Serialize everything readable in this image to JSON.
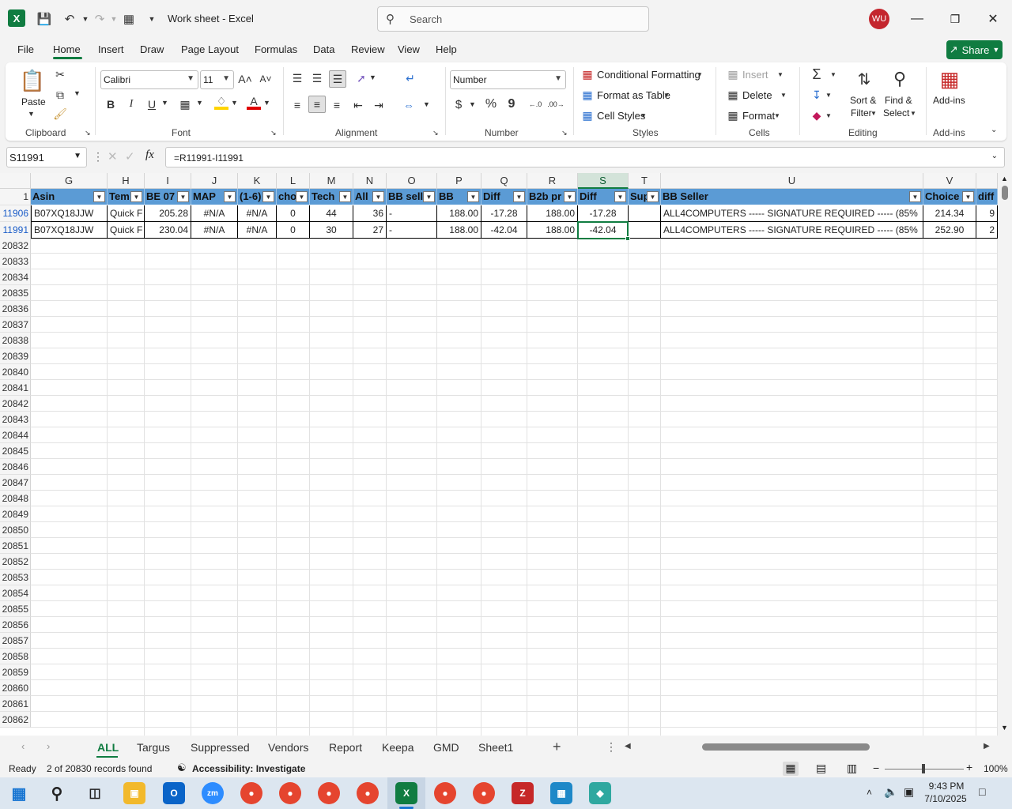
{
  "app": {
    "doc_title": "Work sheet  -  Excel",
    "search_placeholder": "Search",
    "user_initials": "WU",
    "share_label": "Share"
  },
  "menu": [
    "File",
    "Home",
    "Insert",
    "Draw",
    "Page Layout",
    "Formulas",
    "Data",
    "Review",
    "View",
    "Help"
  ],
  "ribbon": {
    "clipboard": {
      "label": "Clipboard",
      "paste": "Paste"
    },
    "font": {
      "label": "Font",
      "name": "Calibri",
      "size": "11",
      "bold": "B",
      "italic": "I",
      "underline": "U"
    },
    "alignment": {
      "label": "Alignment"
    },
    "number": {
      "label": "Number",
      "format": "Number",
      "currency": "$",
      "percent": "%",
      "comma": "9"
    },
    "styles": {
      "label": "Styles",
      "conditional": "Conditional Formatting",
      "format_table": "Format as Table",
      "cell_styles": "Cell Styles"
    },
    "cells": {
      "label": "Cells",
      "insert": "Insert",
      "delete": "Delete",
      "format": "Format"
    },
    "editing": {
      "label": "Editing",
      "sort_filter_1": "Sort &",
      "sort_filter_2": "Filter",
      "find_select_1": "Find &",
      "find_select_2": "Select"
    },
    "addins": {
      "label": "Add-ins",
      "addins_btn": "Add-ins"
    }
  },
  "formula_bar": {
    "name_box": "S11991",
    "fx": "fx",
    "formula": "=R11991-I11991"
  },
  "columns": [
    "G",
    "H",
    "I",
    "J",
    "K",
    "L",
    "M",
    "N",
    "O",
    "P",
    "Q",
    "R",
    "S",
    "T",
    "U",
    "V",
    ""
  ],
  "header_row_number": "1",
  "headers": [
    "Asin",
    "Tem",
    "BE 07",
    "MAP",
    "(1-6)",
    "cho",
    "Tech",
    "All",
    "BB sell",
    "BB",
    "Diff",
    "B2b pr",
    "Diff",
    "Sup",
    "BB Seller",
    "Choice",
    "diff"
  ],
  "data_rows": [
    {
      "row": "11906",
      "cells": [
        "B07XQ18JJW",
        "Quick F",
        "205.28",
        "#N/A",
        "#N/A",
        "0",
        "44",
        "36",
        "-",
        "188.00",
        "-17.28",
        "188.00",
        "-17.28",
        "",
        "ALL4COMPUTERS ----- SIGNATURE REQUIRED ----- (85%",
        "214.34",
        "9"
      ]
    },
    {
      "row": "11991",
      "cells": [
        "B07XQ18JJW",
        "Quick F",
        "230.04",
        "#N/A",
        "#N/A",
        "0",
        "30",
        "27",
        "-",
        "188.00",
        "-42.04",
        "188.00",
        "-42.04",
        "",
        "ALL4COMPUTERS ----- SIGNATURE REQUIRED ----- (85%",
        "252.90",
        "2"
      ]
    }
  ],
  "empty_rows": [
    "20832",
    "20833",
    "20834",
    "20835",
    "20836",
    "20837",
    "20838",
    "20839",
    "20840",
    "20841",
    "20842",
    "20843",
    "20844",
    "20845",
    "20846",
    "20847",
    "20848",
    "20849",
    "20850",
    "20851",
    "20852",
    "20853",
    "20854",
    "20855",
    "20856",
    "20857",
    "20858",
    "20859",
    "20860",
    "20861",
    "20862"
  ],
  "sheets": [
    "ALL",
    "Targus",
    "Suppressed",
    "Vendors",
    "Report",
    "Keepa",
    "GMD",
    "Sheet1"
  ],
  "active_sheet": "ALL",
  "status": {
    "ready": "Ready",
    "records": "2 of 20830 records found",
    "accessibility": "Accessibility: Investigate",
    "zoom": "100%"
  },
  "taskbar": {
    "time": "9:43 PM",
    "date": "7/10/2025"
  },
  "colors": {
    "excel_green": "#107c41",
    "header_blue": "#5b9bd5",
    "avatar_red": "#c4262e"
  }
}
